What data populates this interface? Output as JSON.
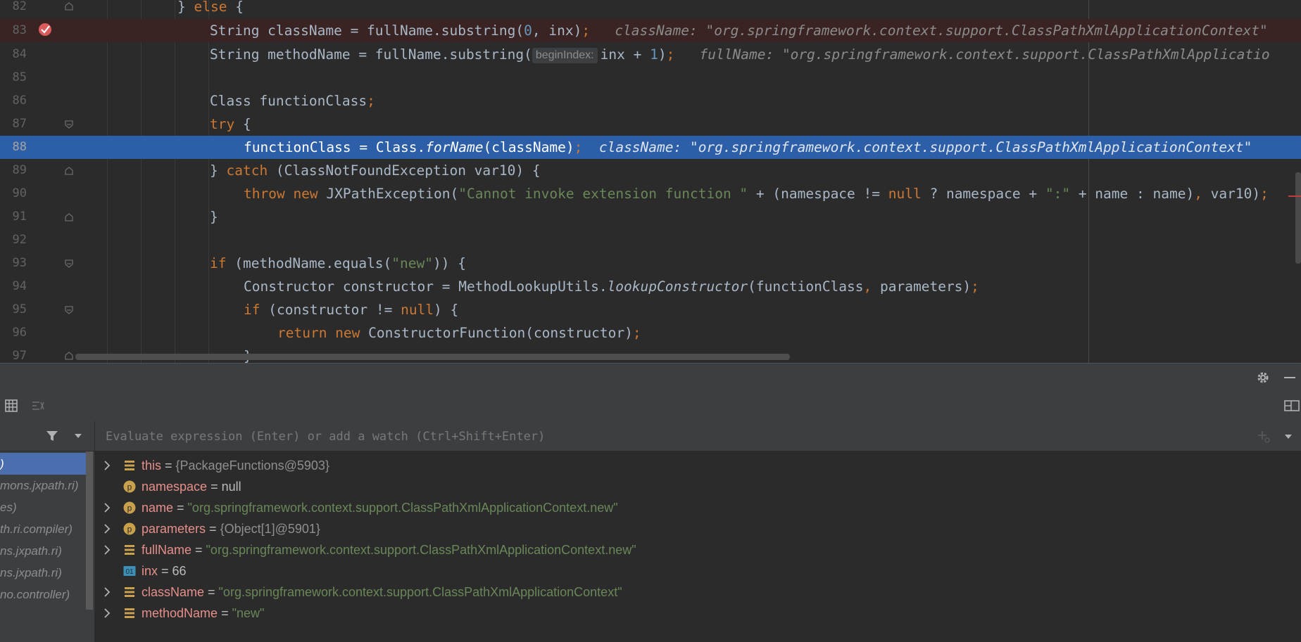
{
  "editor": {
    "lines": [
      {
        "num": "82",
        "text": "} else {"
      },
      {
        "num": "83",
        "text": "String className = fullName.substring(0, inx);",
        "hint": "className: \"org.springframework.context.support.ClassPathXmlApplicationContext\""
      },
      {
        "num": "84",
        "text": "String methodName = fullName.substring( beginIndex: inx + 1);",
        "param_hint": "beginIndex:",
        "hint": "fullName: \"org.springframework.context.support.ClassPathXmlApplicatio"
      },
      {
        "num": "85",
        "text": ""
      },
      {
        "num": "86",
        "text": "Class functionClass;"
      },
      {
        "num": "87",
        "text": "try {"
      },
      {
        "num": "88",
        "text": "functionClass = Class.forName(className);",
        "hint": "className: \"org.springframework.context.support.ClassPathXmlApplicationContext\""
      },
      {
        "num": "89",
        "text": "} catch (ClassNotFoundException var10) {"
      },
      {
        "num": "90",
        "text": "throw new JXPathException(\"Cannot invoke extension function \" + (namespace != null ? namespace + \":\" + name : name), var10);"
      },
      {
        "num": "91",
        "text": "}"
      },
      {
        "num": "92",
        "text": ""
      },
      {
        "num": "93",
        "text": "if (methodName.equals(\"new\")) {"
      },
      {
        "num": "94",
        "text": "Constructor constructor = MethodLookupUtils.lookupConstructor(functionClass, parameters);"
      },
      {
        "num": "95",
        "text": "if (constructor != null) {"
      },
      {
        "num": "96",
        "text": "return new ConstructorFunction(constructor);"
      },
      {
        "num": "97",
        "text": "}"
      }
    ]
  },
  "debugger": {
    "watch_placeholder": "Evaluate expression (Enter) or add a watch (Ctrl+Shift+Enter)",
    "frames": [
      ")",
      "mons.jxpath.ri)",
      "es)",
      "th.ri.compiler)",
      "ns.jxpath.ri)",
      "ns.jxpath.ri)",
      "no.controller)"
    ],
    "variables": [
      {
        "name": "this",
        "value": "{PackageFunctions@5903}",
        "icon": "field-icon",
        "expandable": true,
        "kind": "obj"
      },
      {
        "name": "namespace",
        "value": "null",
        "icon": "parameter-icon",
        "expandable": false,
        "kind": "plain"
      },
      {
        "name": "name",
        "value": "\"org.springframework.context.support.ClassPathXmlApplicationContext.new\"",
        "icon": "parameter-icon",
        "expandable": true,
        "kind": "str"
      },
      {
        "name": "parameters",
        "value": "{Object[1]@5901}",
        "icon": "parameter-icon",
        "expandable": true,
        "kind": "obj"
      },
      {
        "name": "fullName",
        "value": "\"org.springframework.context.support.ClassPathXmlApplicationContext.new\"",
        "icon": "field-icon",
        "expandable": true,
        "kind": "str"
      },
      {
        "name": "inx",
        "value": "66",
        "icon": "primitive-icon",
        "expandable": false,
        "kind": "plain"
      },
      {
        "name": "className",
        "value": "\"org.springframework.context.support.ClassPathXmlApplicationContext\"",
        "icon": "field-icon",
        "expandable": true,
        "kind": "str"
      },
      {
        "name": "methodName",
        "value": "\"new\"",
        "icon": "field-icon",
        "expandable": true,
        "kind": "str"
      }
    ]
  },
  "icons": {
    "panel_header": [
      "gear-icon",
      "minimize-icon"
    ],
    "toolbar": [
      "table-view-icon",
      "compare-icon",
      "layout-icon"
    ],
    "filter": [
      "filter-icon",
      "dropdown-arrow-icon"
    ],
    "watch": [
      "add-watch-icon",
      "watch-dropdown-icon"
    ]
  },
  "colors": {
    "current_line": "#2d5fa8",
    "breakpoint_line": "#3a2323",
    "keyword": "#cc7832",
    "string": "#6a8759",
    "number": "#6897bb",
    "var_name": "#e68f8b"
  }
}
